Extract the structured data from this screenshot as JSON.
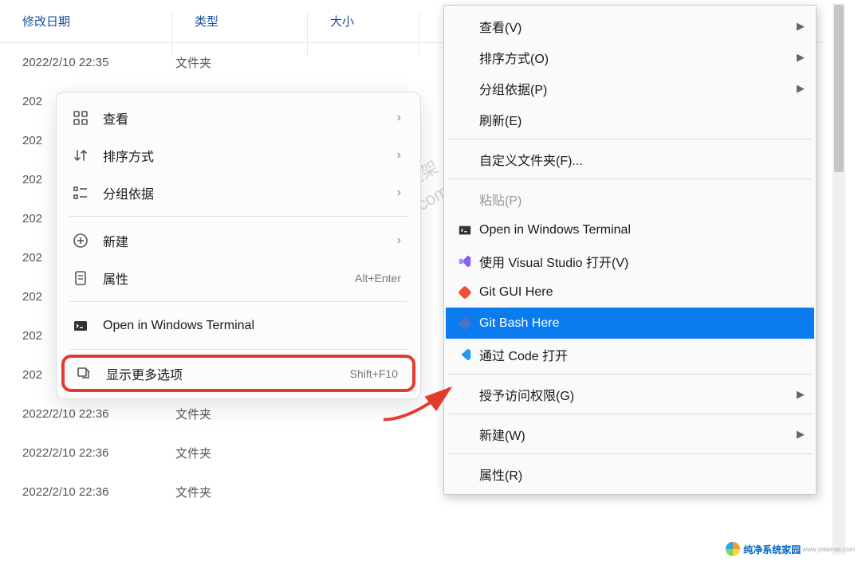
{
  "columns": {
    "date": "修改日期",
    "type": "类型",
    "size": "大小"
  },
  "rows": [
    {
      "date": "2022/2/10 22:35",
      "type": "文件夹"
    },
    {
      "date": "202",
      "type": ""
    },
    {
      "date": "202",
      "type": ""
    },
    {
      "date": "202",
      "type": ""
    },
    {
      "date": "202",
      "type": ""
    },
    {
      "date": "202",
      "type": ""
    },
    {
      "date": "202",
      "type": ""
    },
    {
      "date": "202",
      "type": ""
    },
    {
      "date": "202",
      "type": ""
    },
    {
      "date": "2022/2/10 22:36",
      "type": "文件夹"
    },
    {
      "date": "2022/2/10 22:36",
      "type": "文件夹"
    },
    {
      "date": "2022/2/10 22:36",
      "type": "文件夹"
    }
  ],
  "cm11": {
    "view": "查看",
    "sort": "排序方式",
    "group": "分组依据",
    "new": "新建",
    "properties": "属性",
    "properties_shortcut": "Alt+Enter",
    "terminal": "Open in Windows Terminal",
    "more": "显示更多选项",
    "more_shortcut": "Shift+F10"
  },
  "classic": {
    "view": "查看(V)",
    "sort": "排序方式(O)",
    "group": "分组依据(P)",
    "refresh": "刷新(E)",
    "customize": "自定义文件夹(F)...",
    "paste": "粘贴(P)",
    "terminal": "Open in Windows Terminal",
    "vs_open": "使用 Visual Studio 打开(V)",
    "git_gui": "Git GUI Here",
    "git_bash": "Git Bash Here",
    "code_open": "通过 Code 打开",
    "grant_access": "授予访问权限(G)",
    "new": "新建(W)",
    "properties": "属性(R)"
  },
  "watermark": {
    "line1": "YES dotnet开发框架",
    "line2": "www.yesdotnet.com"
  },
  "footer": {
    "brand": "纯净系统家园",
    "url": "www.yidaimei.com"
  }
}
